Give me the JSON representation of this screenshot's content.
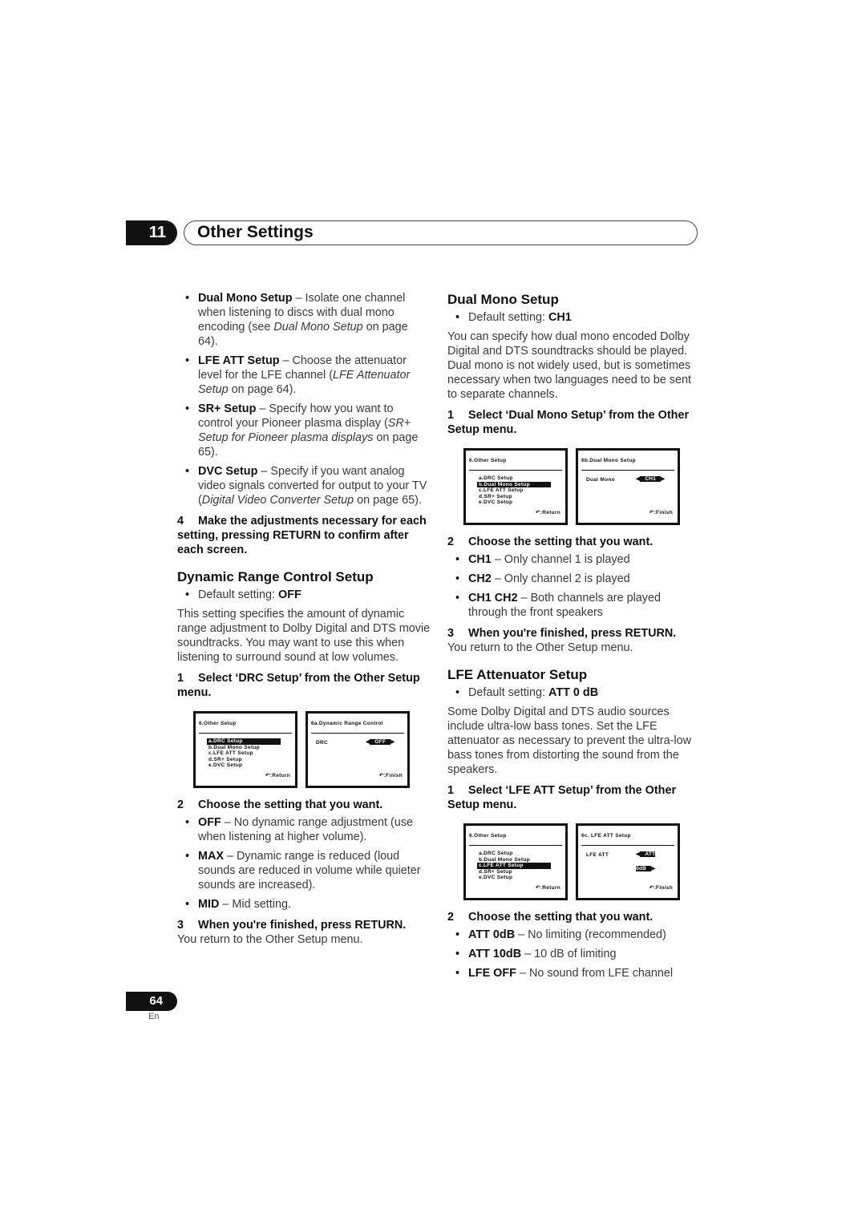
{
  "chapter": {
    "number": "11",
    "title": "Other Settings"
  },
  "left": {
    "intro_bullets": [
      {
        "term": "Dual Mono Setup",
        "text": " – Isolate one channel when listening to discs with dual mono encoding (see ",
        "ref": "Dual Mono Setup",
        "tail": " on page 64)."
      },
      {
        "term": "LFE ATT Setup",
        "text": " – Choose the attenuator level for the LFE channel (",
        "ref": "LFE Attenuator Setup",
        "tail": " on page 64)."
      },
      {
        "term": "SR+ Setup",
        "text": " – Specify how you want to control your Pioneer plasma display (",
        "ref": "SR+ Setup for Pioneer plasma displays",
        "tail": " on page 65)."
      },
      {
        "term": "DVC Setup",
        "text": " – Specify if you want analog video signals converted for output to your TV (",
        "ref": "Digital Video Converter Setup",
        "tail": " on page 65)."
      }
    ],
    "step4": {
      "num": "4",
      "text": "Make the adjustments necessary for each setting, pressing RETURN to confirm after each screen."
    },
    "drc": {
      "heading": "Dynamic Range Control Setup",
      "default_label": "Default setting: ",
      "default_value": "OFF",
      "body": "This setting specifies the amount of dynamic range adjustment to Dolby Digital and DTS movie soundtracks. You may want to use this when listening to surround sound at low volumes.",
      "step1": {
        "num": "1",
        "text": "Select ‘DRC Setup’ from the Other Setup menu."
      },
      "screen_menu": {
        "title": "6.Other Setup",
        "items": [
          "a.DRC Setup",
          "b.Dual Mono Setup",
          "c.LFE ATT Setup",
          "d.SR+ Setup",
          "e.DVC Setup"
        ],
        "selected": 0,
        "footer": "↶:Return"
      },
      "screen_setting": {
        "title": "6a.Dynamic Range Control",
        "label": "DRC",
        "value": "OFF",
        "footer": "↶:Finish"
      },
      "step2": {
        "num": "2",
        "text": "Choose the setting that you want."
      },
      "options": [
        {
          "term": "OFF",
          "text": " – No dynamic range adjustment (use when listening at higher volume)."
        },
        {
          "term": "MAX",
          "text": " – Dynamic range is reduced (loud sounds are reduced in volume while quieter sounds are increased)."
        },
        {
          "term": "MID",
          "text": " – Mid setting."
        }
      ],
      "step3": {
        "num": "3",
        "text": "When you're finished, press RETURN."
      },
      "return_text": "You return to the Other Setup menu."
    }
  },
  "right": {
    "dual": {
      "heading": "Dual Mono Setup",
      "default_label": "Default setting: ",
      "default_value": "CH1",
      "body": "You can specify how dual mono encoded Dolby Digital and DTS soundtracks should be played. Dual mono is not widely used, but is sometimes necessary when two languages need to be sent to separate channels.",
      "step1": {
        "num": "1",
        "text": "Select ‘Dual Mono Setup’ from the Other Setup menu."
      },
      "screen_menu": {
        "title": "6.Other Setup",
        "items": [
          "a.DRC Setup",
          "b.Dual Mono Setup",
          "c.LFE ATT Setup",
          "d.SR+ Setup",
          "e.DVC Setup"
        ],
        "selected": 1,
        "footer": "↶:Return"
      },
      "screen_setting": {
        "title": "6b.Dual Mono Setup",
        "label": "Dual Mono",
        "value": "CH1",
        "footer": "↶:Finish"
      },
      "step2": {
        "num": "2",
        "text": "Choose the setting that you want."
      },
      "options": [
        {
          "term": "CH1",
          "text": " – Only channel 1 is played"
        },
        {
          "term": "CH2",
          "text": " – Only channel 2 is played"
        },
        {
          "term": "CH1 CH2",
          "text": " – Both channels are played through the front speakers"
        }
      ],
      "step3": {
        "num": "3",
        "text": "When you're finished, press RETURN."
      },
      "return_text": "You return to the Other Setup menu."
    },
    "lfe": {
      "heading": "LFE Attenuator Setup",
      "default_label": "Default setting: ",
      "default_value": "ATT 0 dB",
      "body": "Some Dolby Digital and DTS audio sources include ultra-low bass tones. Set the LFE attenuator as necessary to prevent the ultra-low bass tones from distorting the sound from the speakers.",
      "step1": {
        "num": "1",
        "text": "Select ‘LFE ATT Setup’ from the Other Setup menu."
      },
      "screen_menu": {
        "title": "6.Other Setup",
        "items": [
          "a.DRC Setup",
          "b.Dual Mono Setup",
          "c.LFE ATT Setup",
          "d.SR+ Setup",
          "e.DVC Setup"
        ],
        "selected": 2,
        "footer": "↶:Return"
      },
      "screen_setting": {
        "title": "6c. LFE ATT Setup",
        "label": "LFE ATT",
        "value": "ATT 0dB",
        "footer": "↶:Finish"
      },
      "step2": {
        "num": "2",
        "text": "Choose the setting that you want."
      },
      "options": [
        {
          "term": "ATT 0dB",
          "text": " – No limiting (recommended)"
        },
        {
          "term": "ATT 10dB",
          "text": " – 10 dB of limiting"
        },
        {
          "term": "LFE OFF",
          "text": " – No sound from LFE channel"
        }
      ]
    }
  },
  "footer": {
    "page": "64",
    "lang": "En"
  }
}
